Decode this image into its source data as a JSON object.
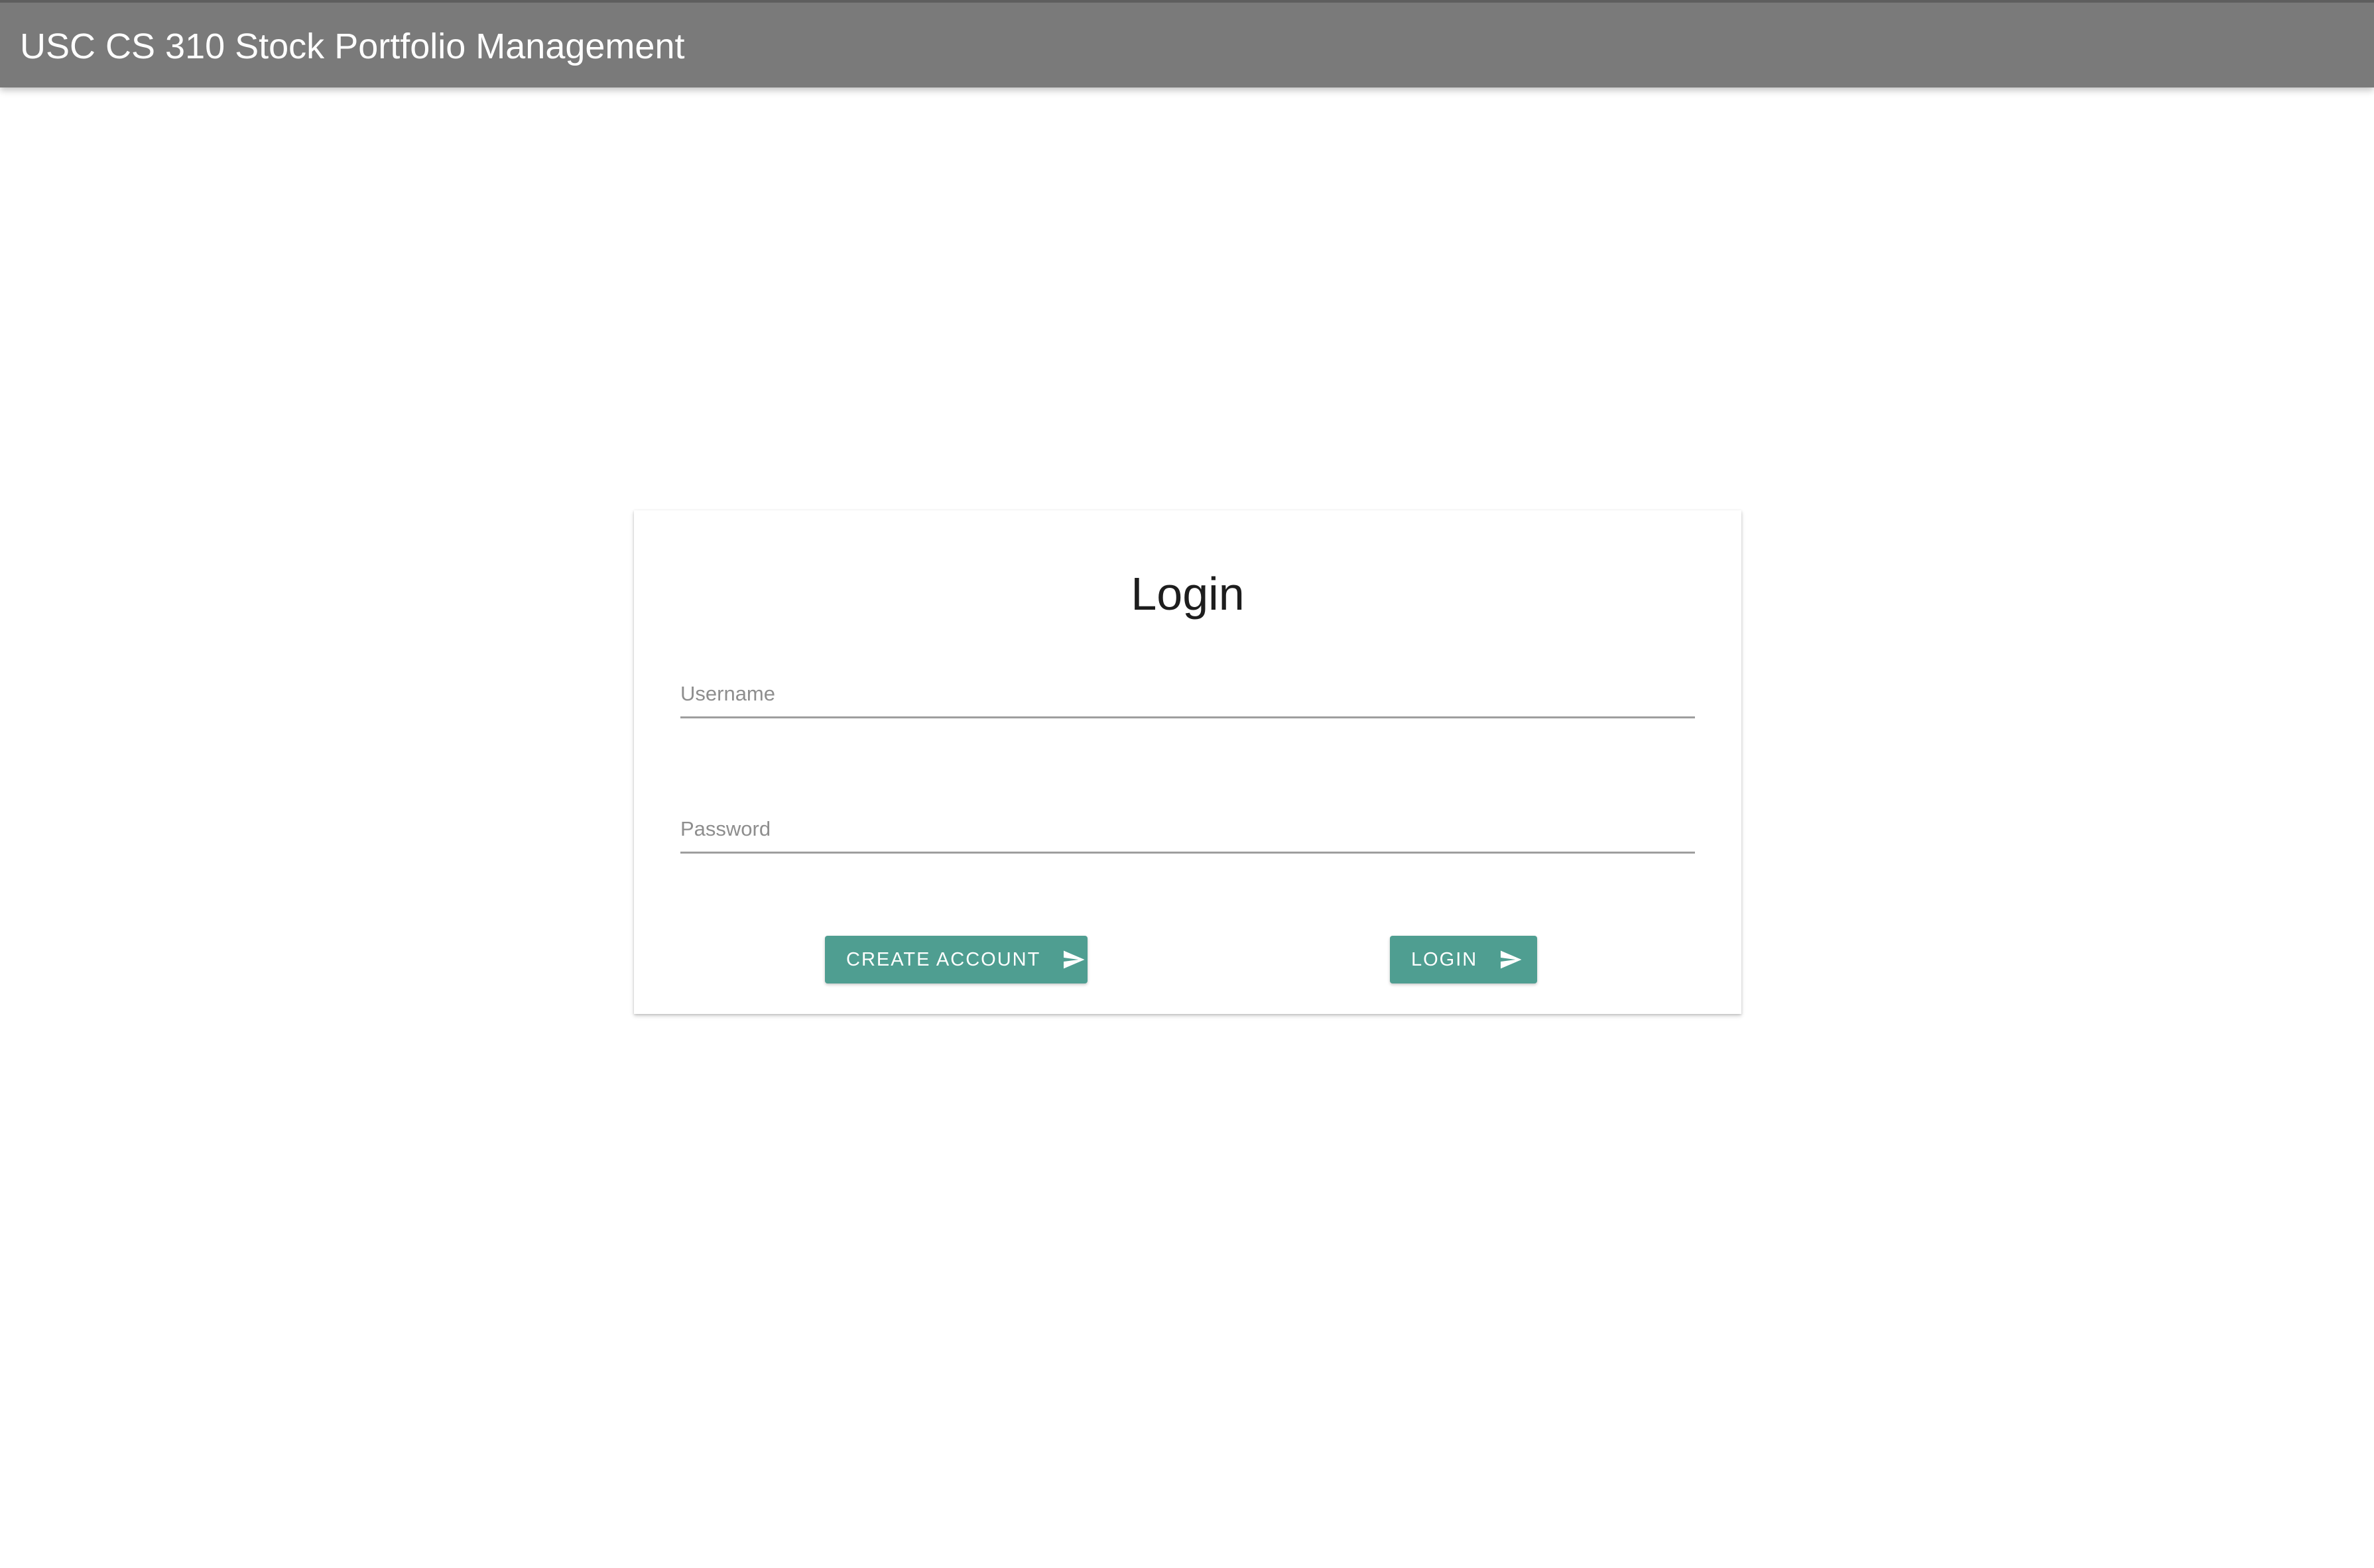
{
  "header": {
    "title": "USC CS 310 Stock Portfolio Management"
  },
  "login_card": {
    "title": "Login",
    "username_placeholder": "Username",
    "password_placeholder": "Password",
    "create_account_label": "CREATE ACCOUNT",
    "login_label": "LOGIN",
    "button_icon": "send-icon"
  },
  "colors": {
    "header_bg": "#7a7a7a",
    "button_bg": "#4f9e91"
  }
}
